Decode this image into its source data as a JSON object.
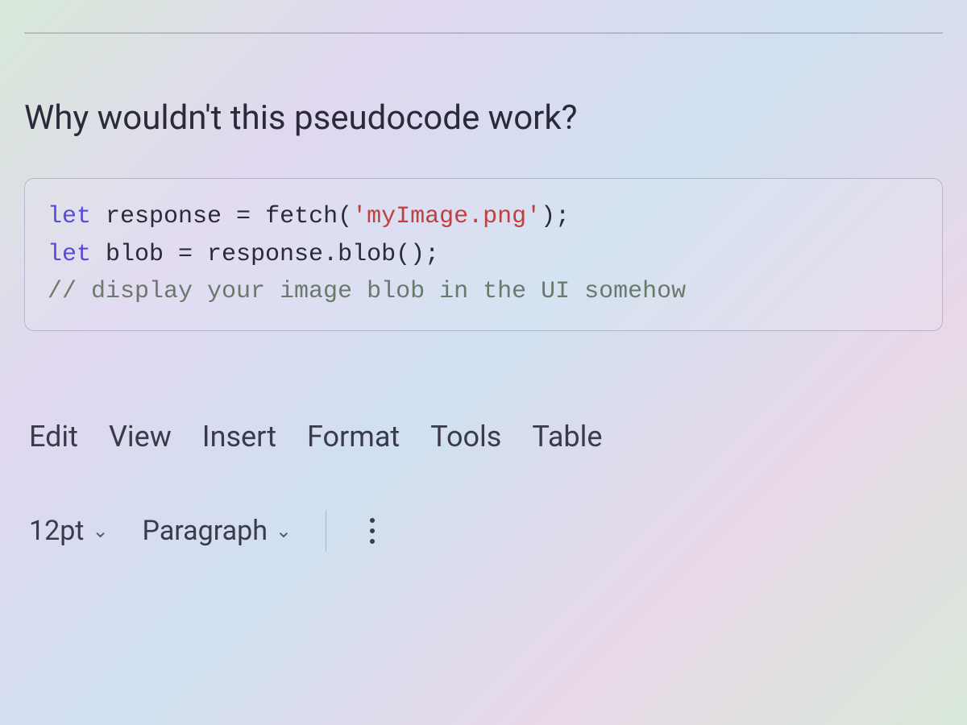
{
  "question": {
    "title": "Why wouldn't this pseudocode work?",
    "code_lines": [
      {
        "segments": [
          {
            "text": "let",
            "class": "code-keyword"
          },
          {
            "text": " response = ",
            "class": ""
          },
          {
            "text": "fetch",
            "class": "code-func"
          },
          {
            "text": "(",
            "class": ""
          },
          {
            "text": "'myImage.png'",
            "class": "code-string"
          },
          {
            "text": ");",
            "class": ""
          }
        ]
      },
      {
        "segments": [
          {
            "text": "let",
            "class": "code-keyword"
          },
          {
            "text": " blob = response.",
            "class": ""
          },
          {
            "text": "blob",
            "class": "code-func"
          },
          {
            "text": "();",
            "class": ""
          }
        ]
      },
      {
        "segments": [
          {
            "text": "// display your image blob in the UI somehow",
            "class": "code-comment"
          }
        ]
      }
    ]
  },
  "editor": {
    "menubar": [
      "Edit",
      "View",
      "Insert",
      "Format",
      "Tools",
      "Table"
    ],
    "toolbar": {
      "font_size": "12pt",
      "style": "Paragraph"
    }
  }
}
